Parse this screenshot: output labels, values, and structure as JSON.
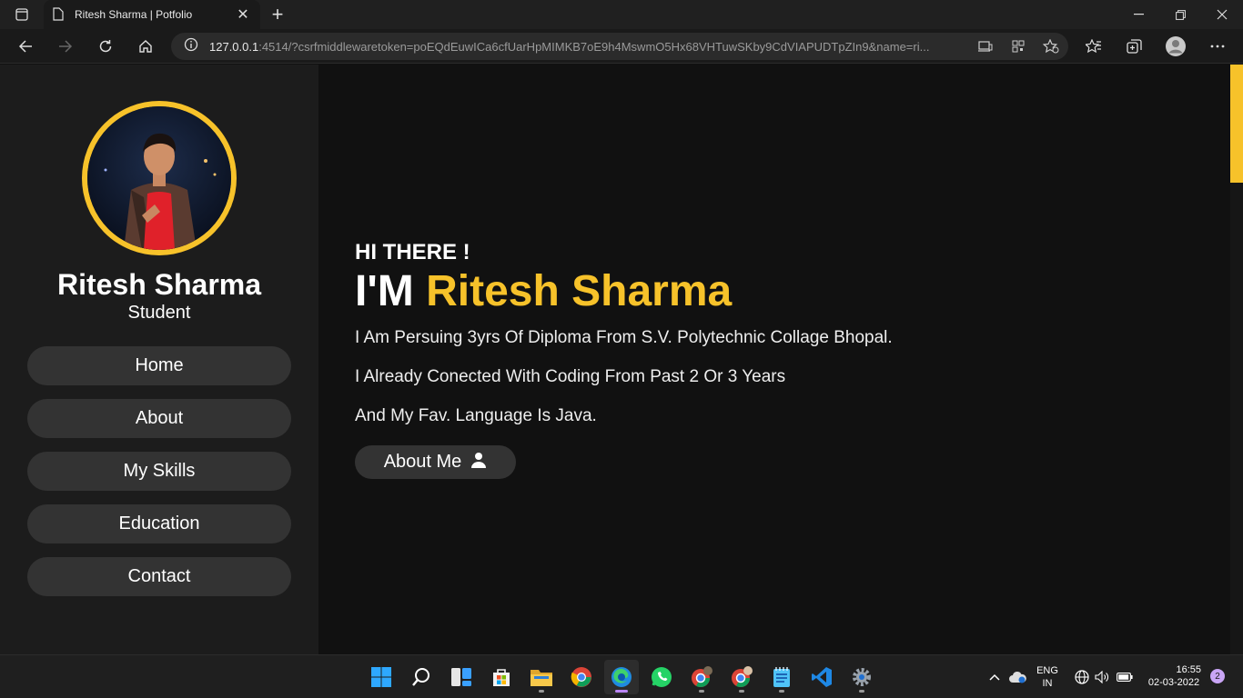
{
  "browser": {
    "tab_title": "Ritesh Sharma | Potfolio",
    "url_host": "127.0.0.1",
    "url_rest": ":4514/?csrfmiddlewaretoken=poEQdEuwICa6cfUarHpMIMKB7oE9h4MswmO5Hx68VHTuwSKby9CdVIAPUDTpZIn9&name=ri..."
  },
  "sidebar": {
    "name": "Ritesh Sharma",
    "role": "Student",
    "nav": [
      "Home",
      "About",
      "My Skills",
      "Education",
      "Contact"
    ]
  },
  "hero": {
    "greeting": "HI THERE !",
    "im_prefix": "I'M",
    "highlight_name": "Ritesh Sharma",
    "lines": [
      "I Am Persuing 3yrs Of Diploma From S.V. Polytechnic Collage Bhopal.",
      "I Already Conected With Coding From Past 2 Or 3 Years",
      "And My Fav. Language Is Java."
    ],
    "cta_label": "About Me"
  },
  "taskbar": {
    "lang_line1": "ENG",
    "lang_line2": "IN",
    "time": "16:55",
    "date": "02-03-2022",
    "notification_count": "2"
  },
  "colors": {
    "accent": "#f7c22a",
    "sidebar_bg": "#1c1c1c",
    "page_bg": "#111111",
    "button_bg": "#333333"
  }
}
